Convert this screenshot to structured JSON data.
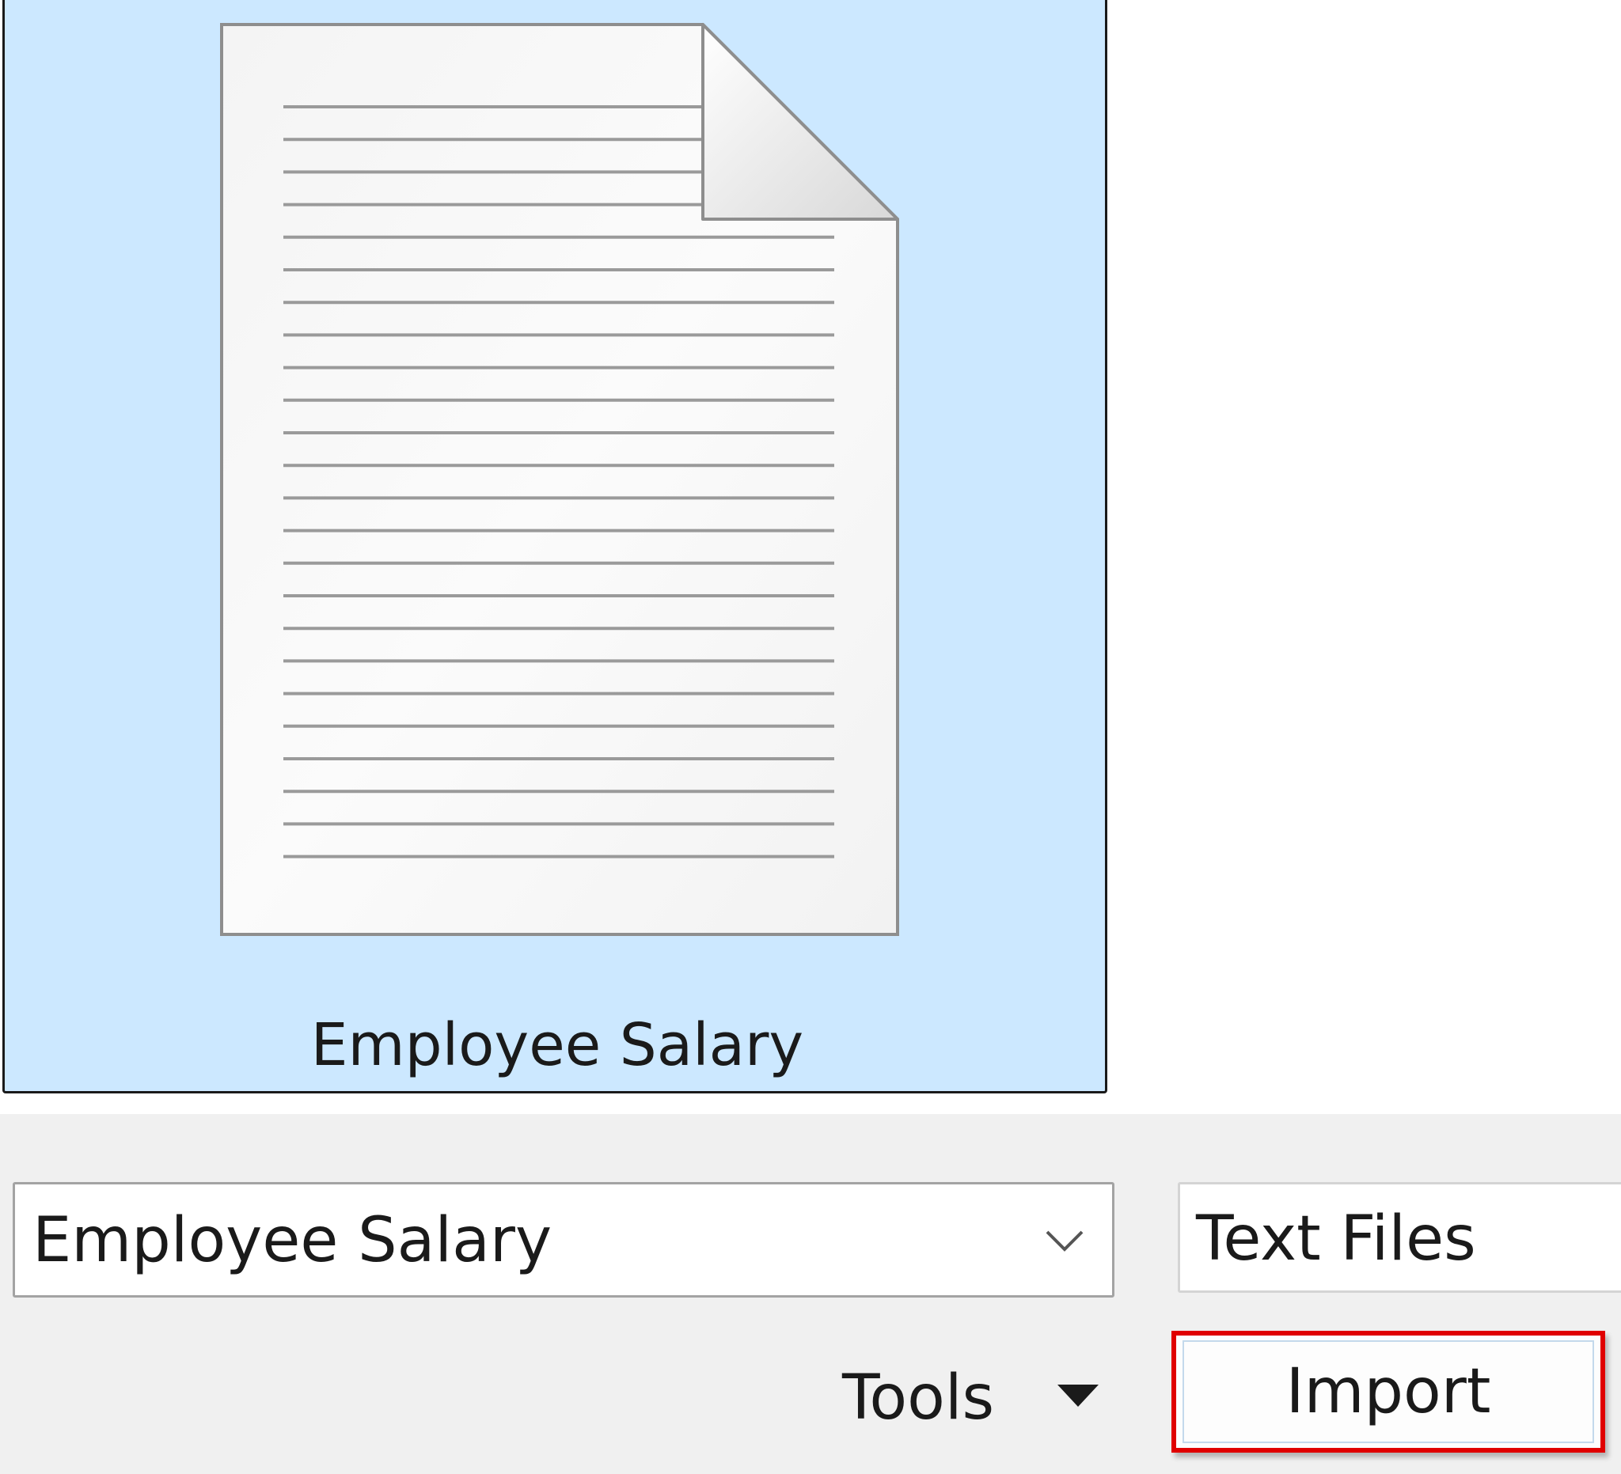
{
  "file_list": {
    "selected_file": {
      "name": "Employee Salary",
      "icon": "text-document-icon"
    }
  },
  "footer": {
    "file_name_value": "Employee Salary",
    "file_type_value": "Text Files",
    "tools_label": "Tools",
    "import_label": "Import"
  },
  "colors": {
    "selection_fill": "#cce8ff",
    "highlight_border": "#e00000"
  }
}
